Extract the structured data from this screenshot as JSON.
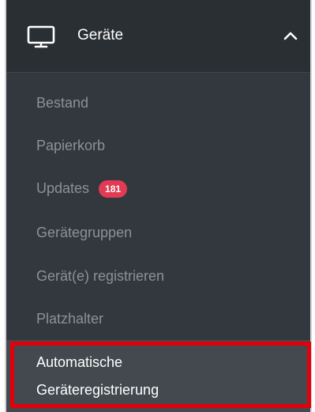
{
  "group": {
    "icon": "monitor-icon",
    "label": "Geräte",
    "toggle_icon": "chevron-up-icon"
  },
  "nav": {
    "items": [
      {
        "label": "Bestand"
      },
      {
        "label": "Papierkorb"
      },
      {
        "label": "Updates",
        "badge": "181"
      },
      {
        "label": "Gerätegruppen"
      },
      {
        "label": "Gerät(e) registrieren"
      },
      {
        "label": "Platzhalter"
      }
    ],
    "active": {
      "line1": "Automatische",
      "line2": "Geräteregistrierung"
    }
  },
  "colors": {
    "sidebar_bg": "#32383e",
    "header_bg": "#2a2f33",
    "active_bg": "#43494e",
    "muted_text": "#8a9197",
    "badge": "#e23b54",
    "highlight": "#e3000b"
  }
}
